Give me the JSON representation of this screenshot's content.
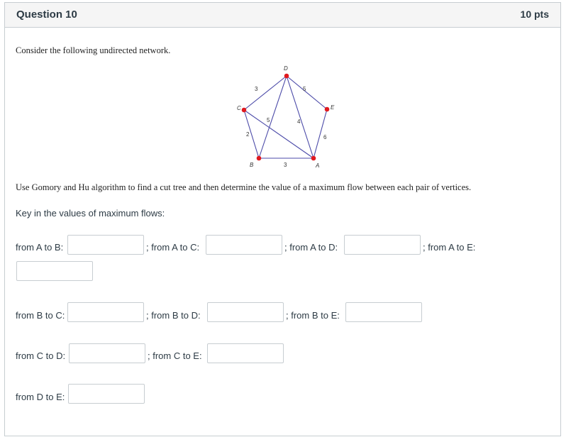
{
  "question": {
    "title": "Question 10",
    "points": "10 pts"
  },
  "intro": "Consider the following undirected network.",
  "network": {
    "nodes": {
      "A": "A",
      "B": "B",
      "C": "C",
      "D": "D",
      "E": "E"
    },
    "edges": {
      "CD": "3",
      "DE": "5",
      "CB_left": "2",
      "CA_inner": "5",
      "DA_inner": "4",
      "EA": "6",
      "BA": "3"
    },
    "node_color": "#e0191f",
    "edge_color": "#4b4aa8"
  },
  "instructions": "Use Gomory and Hu algorithm to find a cut tree  and then determine the value of a maximum flow between each pair of vertices.",
  "key_prompt": "Key in the values of maximum flows:",
  "fields": {
    "ab_label": "from A to B:",
    "ac_label": "; from A to C:",
    "ad_label": "; from A to D:",
    "ae_label": "; from A to E:",
    "bc_label": "from B to C:",
    "bd_label": "; from B to D:",
    "be_label": "; from B to E:",
    "cd_label": "from C to D:",
    "ce_label": "; from C to E:",
    "de_label": "from D to E:",
    "ab_value": "",
    "ac_value": "",
    "ad_value": "",
    "ae_value": "",
    "bc_value": "",
    "bd_value": "",
    "be_value": "",
    "cd_value": "",
    "ce_value": "",
    "de_value": ""
  }
}
